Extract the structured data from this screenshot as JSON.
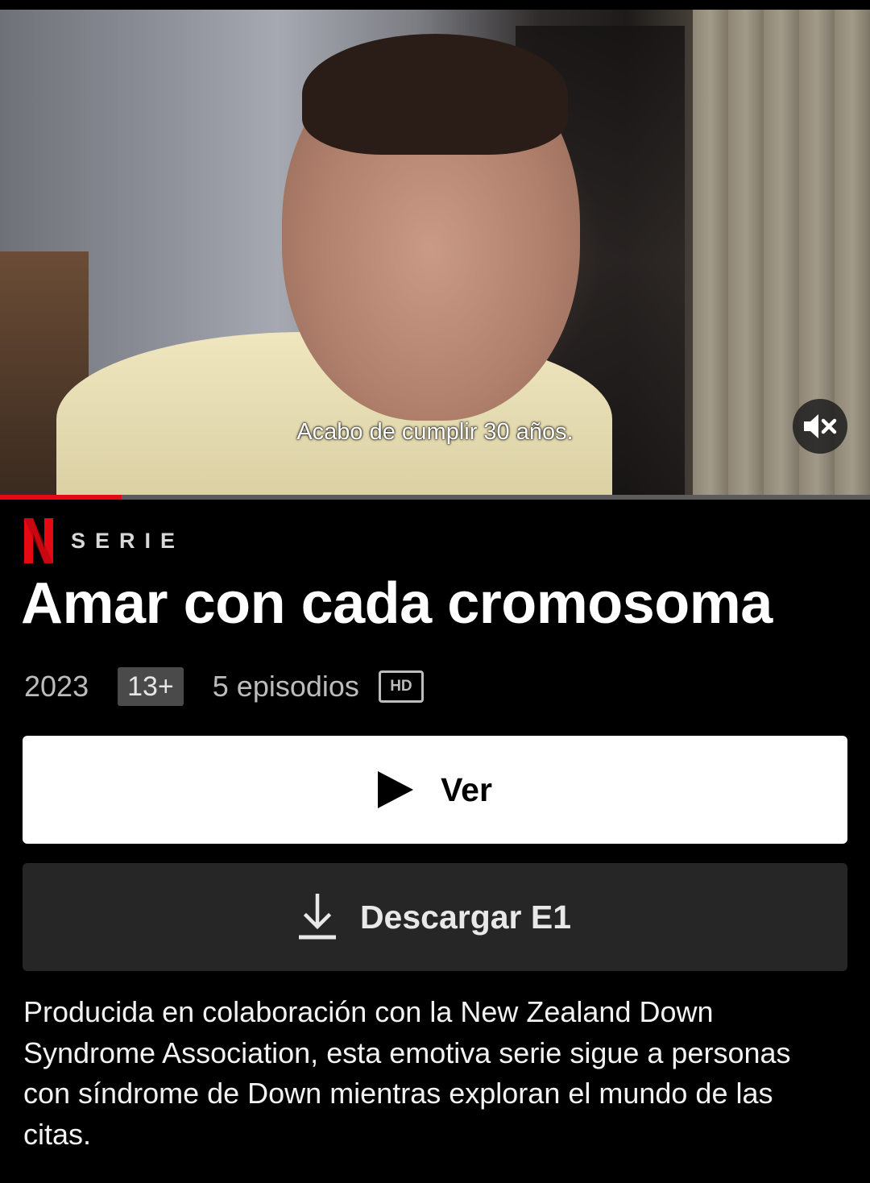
{
  "player": {
    "subtitle": "Acabo de cumplir 30 años.",
    "progress_fraction": 0.14,
    "mute_icon": "volume-muted-icon"
  },
  "brand": {
    "logo_letter": "N",
    "type_label": "SERIE",
    "accent_color": "#e50914"
  },
  "show": {
    "title": "Amar con cada cromosoma",
    "year": "2023",
    "rating": "13+",
    "episodes": "5 episodios",
    "quality": "HD",
    "description": "Producida en colaboración con la New Zealand Down Syndrome Association, esta emotiva serie sigue a personas con síndrome de Down mientras exploran el mundo de las citas."
  },
  "actions": {
    "play_label": "Ver",
    "play_icon": "play-icon",
    "download_label": "Descargar E1",
    "download_icon": "download-icon"
  }
}
